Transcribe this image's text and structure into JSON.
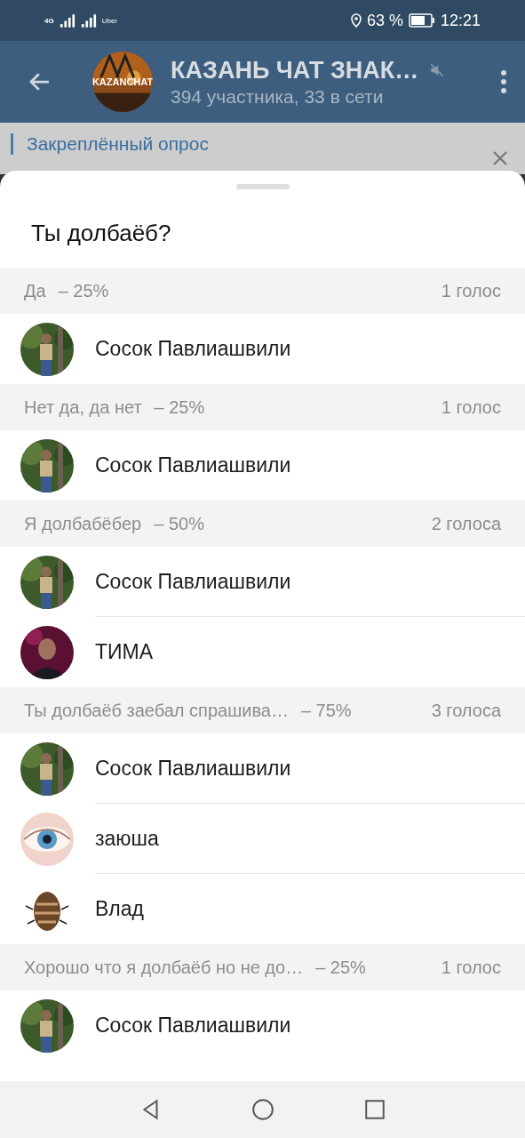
{
  "status_bar": {
    "network": "4G",
    "carrier": "Uber",
    "battery": "63 %",
    "time": "12:21"
  },
  "header": {
    "title": "КАЗАНЬ ЧАТ ЗНАК…",
    "avatar_text": "KAZANCHAT",
    "subtitle": "394 участника, 33 в сети",
    "muted": true
  },
  "pinned": {
    "label": "Закреплённый опрос"
  },
  "poll": {
    "question": "Ты долбаёб?",
    "options": [
      {
        "text": "Да",
        "percent": "– 25%",
        "votes": "1 голос",
        "voters": [
          {
            "name": "Сосок Павлиашвили"
          }
        ]
      },
      {
        "text": "Нет да, да нет",
        "percent": "– 25%",
        "votes": "1 голос",
        "voters": [
          {
            "name": "Сосок Павлиашвили"
          }
        ]
      },
      {
        "text": "Я долбабёбер",
        "percent": "– 50%",
        "votes": "2 голоса",
        "voters": [
          {
            "name": "Сосок Павлиашвили"
          },
          {
            "name": "ТИМА"
          }
        ]
      },
      {
        "text": "Ты долбаёб заебал спрашива…",
        "percent": "– 75%",
        "votes": "3 голоса",
        "voters": [
          {
            "name": "Сосок Павлиашвили"
          },
          {
            "name": "заюша"
          },
          {
            "name": "Влад"
          }
        ]
      },
      {
        "text": "Хорошо что я долбаёб но не до…",
        "percent": "– 25%",
        "votes": "1 голос",
        "voters": [
          {
            "name": "Сосок Павлиашвили"
          }
        ]
      }
    ]
  }
}
